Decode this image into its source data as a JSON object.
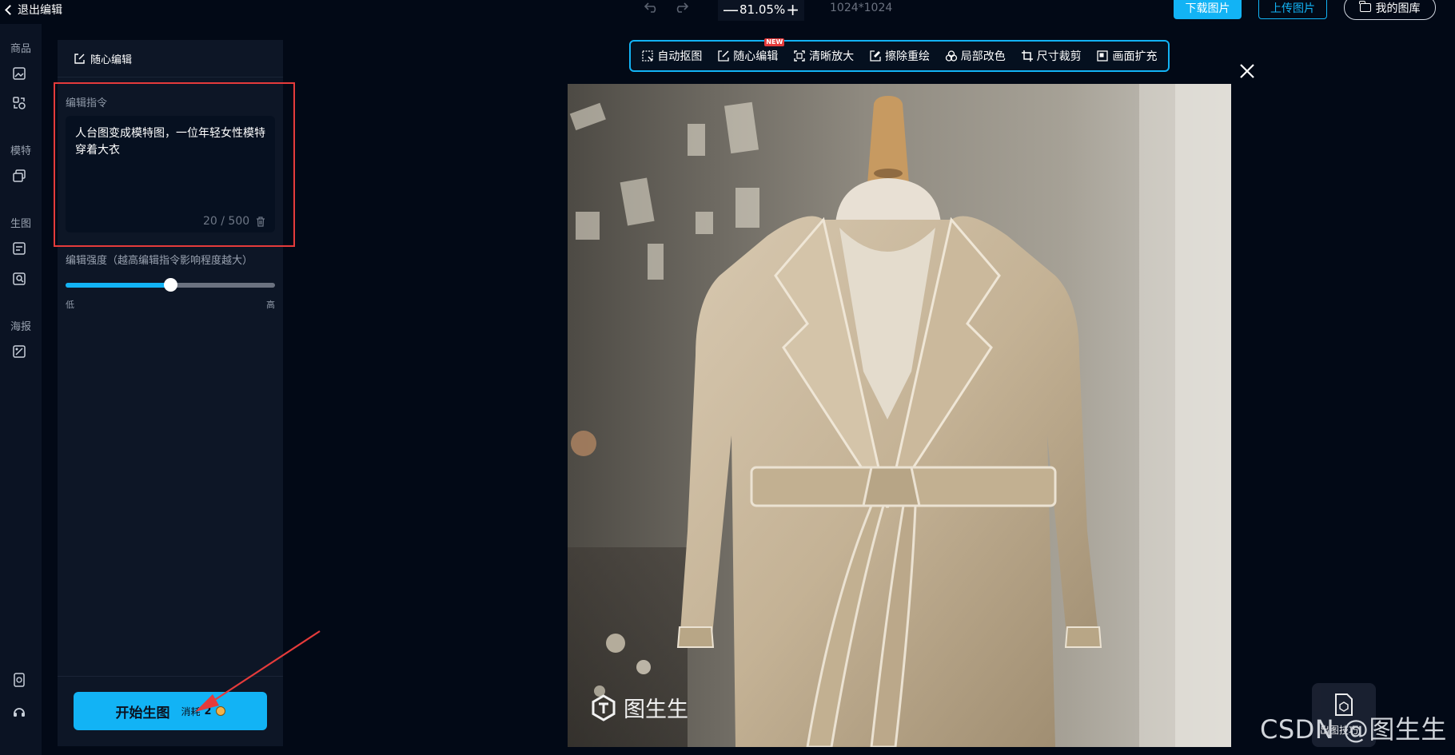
{
  "header": {
    "back_label": "退出编辑",
    "zoom_value": "81.05%",
    "image_size": "1024*1024",
    "download_label": "下载图片",
    "upload_label": "上传图片",
    "library_label": "我的图库"
  },
  "rail": {
    "sections": [
      "商品",
      "模特",
      "生图",
      "海报"
    ]
  },
  "panel": {
    "title": "随心编辑",
    "command_label": "编辑指令",
    "command_text": "人台图变成模特图，一位年轻女性模特穿着大衣",
    "char_count": "20 / 500",
    "strength_label": "编辑强度（越高编辑指令影响程度越大）",
    "strength_level": 0.5,
    "low_label": "低",
    "high_label": "高",
    "generate_label": "开始生图",
    "cost_label": "消耗",
    "cost_value": "2"
  },
  "toolbar": {
    "tools": [
      "自动抠图",
      "随心编辑",
      "清晰放大",
      "擦除重绘",
      "局部改色",
      "尺寸裁剪",
      "画面扩充"
    ],
    "new_badge": "NEW"
  },
  "canvas": {
    "watermark_text": "图生生"
  },
  "float_button": {
    "label": "出图技巧"
  },
  "page_watermark": "CSDN @图生生",
  "colors": {
    "accent": "#12b3f5",
    "background": "#020916",
    "panel": "#0d1626",
    "highlight": "#e53b3b"
  }
}
